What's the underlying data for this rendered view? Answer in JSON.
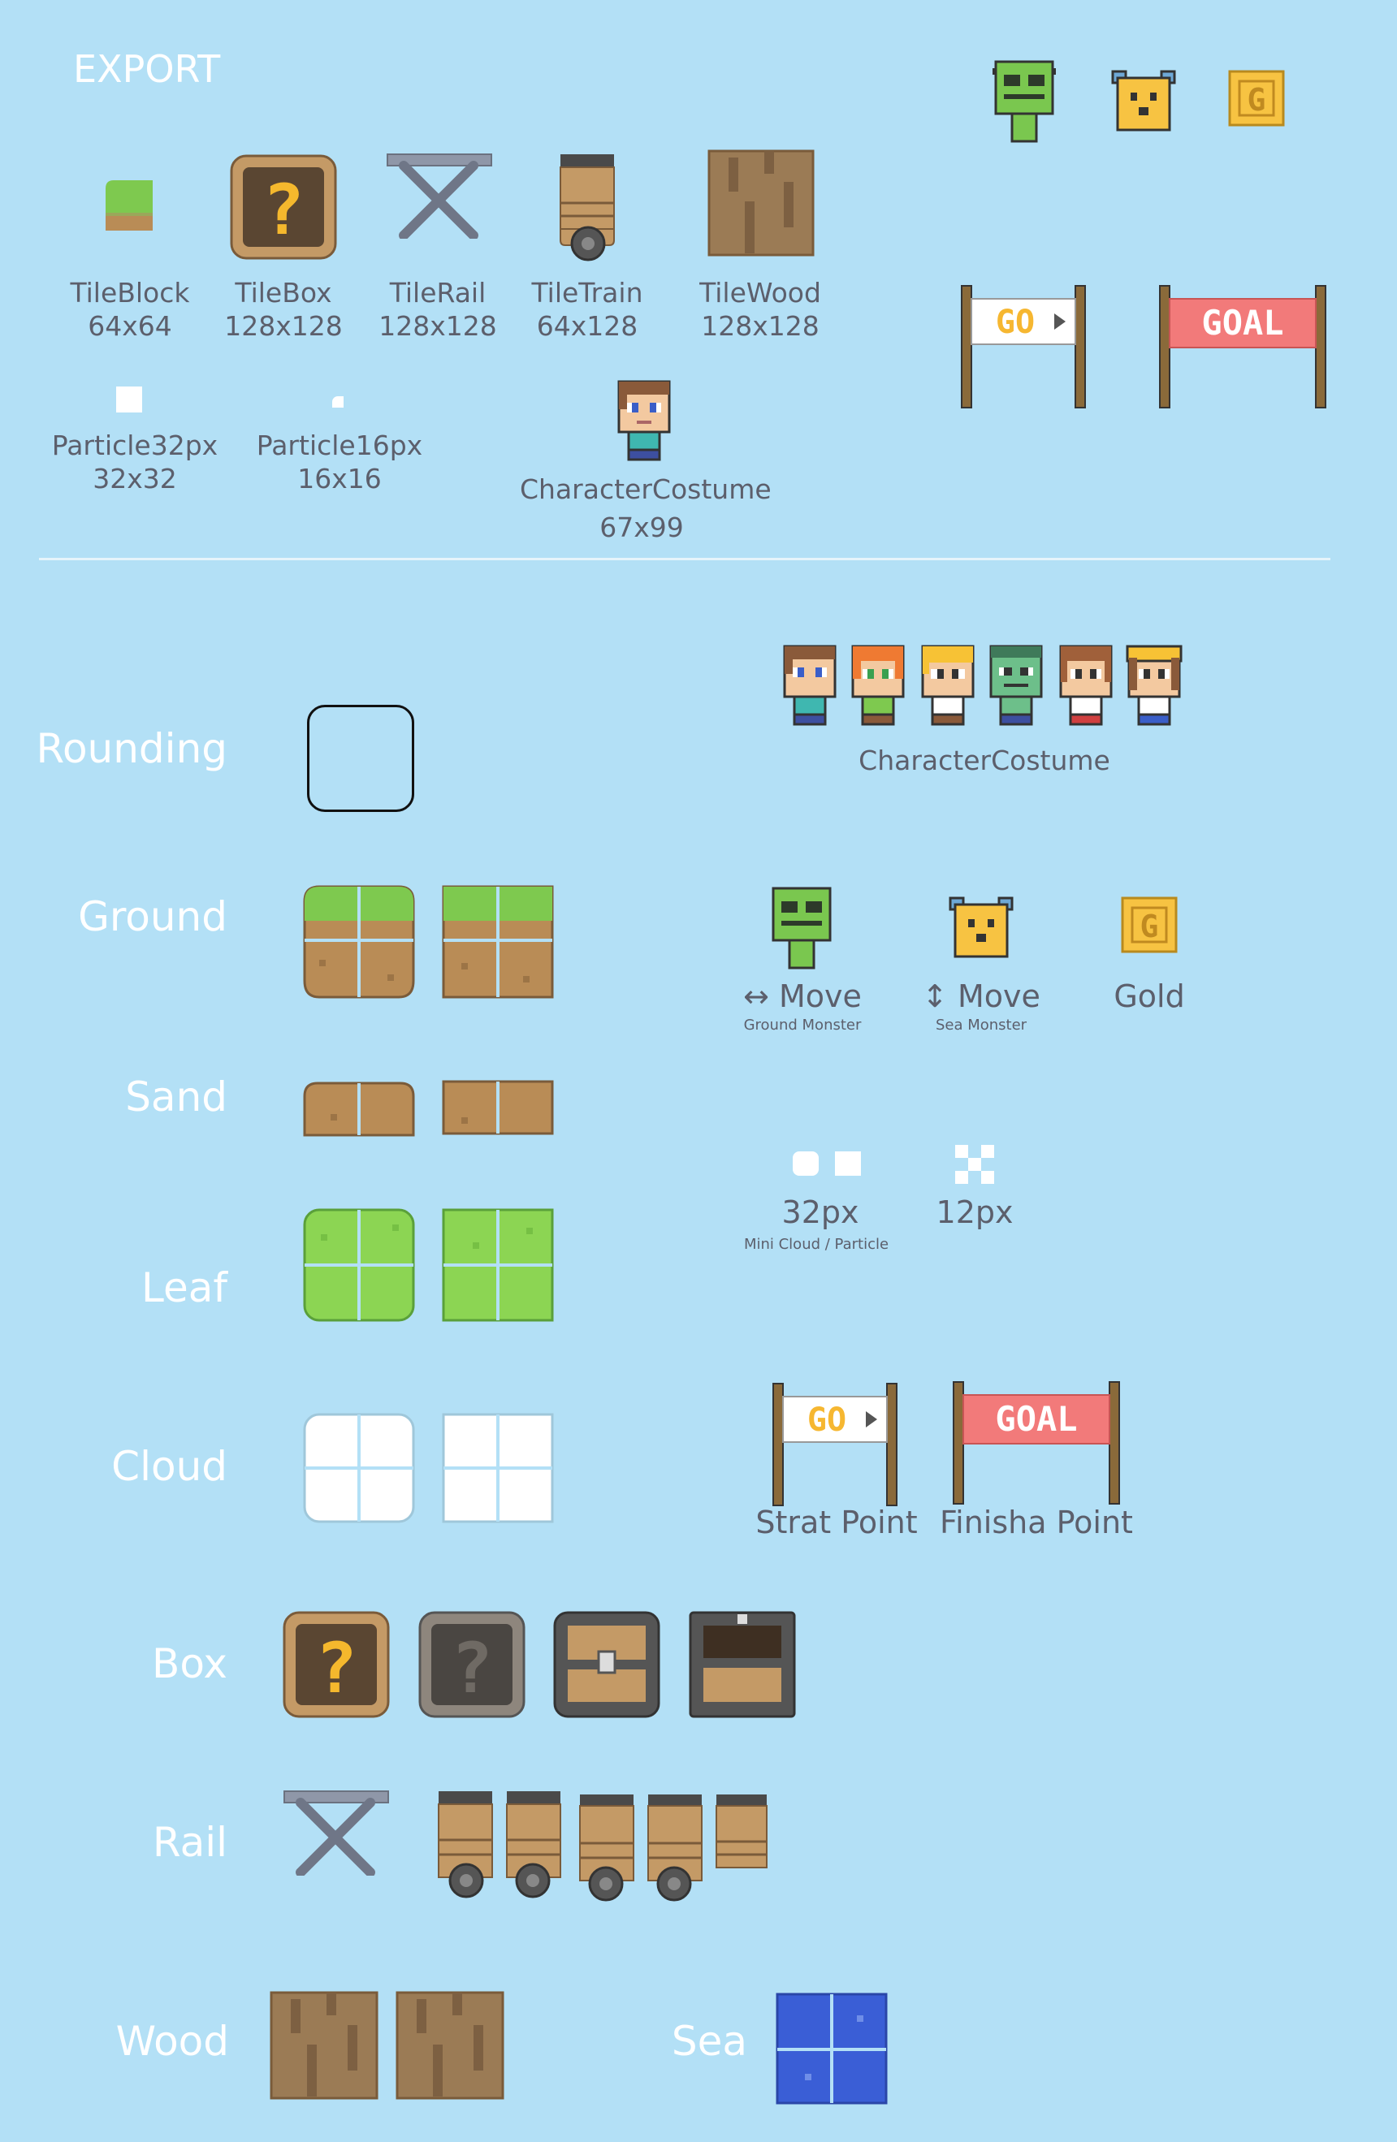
{
  "export": {
    "title": "EXPORT",
    "assets": [
      {
        "name": "TileBlock",
        "size": "64x64"
      },
      {
        "name": "TileBox",
        "size": "128x128"
      },
      {
        "name": "TileRail",
        "size": "128x128"
      },
      {
        "name": "TileTrain",
        "size": "64x128"
      },
      {
        "name": "TileWood",
        "size": "128x128"
      },
      {
        "name": "Particle32px",
        "size": "32x32"
      },
      {
        "name": "Particle16px",
        "size": "16x16"
      },
      {
        "name": "CharacterCostume",
        "size": "67x99"
      }
    ]
  },
  "categories": {
    "rounding": "Rounding",
    "ground": "Ground",
    "sand": "Sand",
    "leaf": "Leaf",
    "cloud": "Cloud",
    "box": "Box",
    "rail": "Rail",
    "wood": "Wood",
    "sea": "Sea"
  },
  "characters": {
    "label": "CharacterCostume"
  },
  "monsters": {
    "ground": {
      "title": "↔ Move",
      "subtitle": "Ground Monster"
    },
    "sea": {
      "title": "↕ Move",
      "subtitle": "Sea Monster"
    },
    "gold": {
      "title": "Gold",
      "glyph": "G"
    }
  },
  "particles": {
    "size_a": "32px",
    "size_a_sub": "Mini Cloud / Particle",
    "size_b": "12px"
  },
  "flags": {
    "start": {
      "sign": "GO",
      "label": "Strat Point"
    },
    "goal": {
      "sign": "GOAL",
      "label": "Finisha Point"
    }
  },
  "box_glyph": "?",
  "colors": {
    "background": "#b3e0f6",
    "grass": "#7ec94f",
    "dirt": "#b98c56",
    "leaf": "#8cd553",
    "cloud": "#ffffff",
    "sea": "#3a5ed6",
    "wood": "#9b7b55",
    "goal": "#f27a7a",
    "go_text": "#f6b731",
    "gold": "#f7c342",
    "ground_monster": "#7ac74f"
  }
}
